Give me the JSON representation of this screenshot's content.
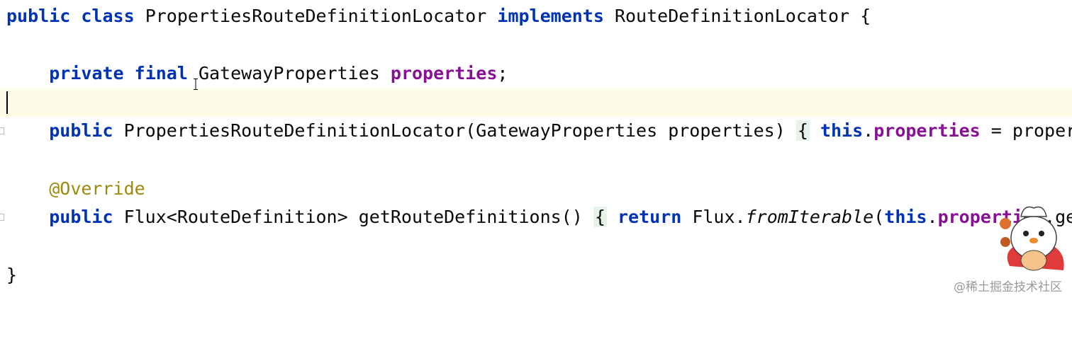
{
  "code": {
    "line1": {
      "kw_public": "public",
      "sp1": " ",
      "kw_class": "class",
      "sp2": " PropertiesRouteDefinitionLocator ",
      "kw_implements": "implements",
      "rest": " RouteDefinitionLocator {"
    },
    "line3": {
      "indent": "    ",
      "kw_private": "private",
      "sp1": " ",
      "kw_final": "final",
      "type": " GatewayProperties ",
      "field": "properties",
      "end": ";"
    },
    "line5": {
      "indent": "    ",
      "kw_public": "public",
      "sig": " PropertiesRouteDefinitionLocator(GatewayProperties properties) ",
      "brace": "{",
      "sp": " ",
      "kw_this": "this",
      "dot": ".",
      "field": "properties",
      "rest": " = properties"
    },
    "line7": {
      "indent": "    ",
      "annotation": "@Override"
    },
    "line8": {
      "indent": "    ",
      "kw_public": "public",
      "sig": " Flux<RouteDefinition> getRouteDefinitions() ",
      "brace": "{",
      "sp": " ",
      "kw_return": "return",
      "flux": " Flux.",
      "method": "fromIterable",
      "paren": "(",
      "kw_this": "this",
      "dot": ".",
      "field": "properties",
      "rest": ".getRou"
    },
    "line10": {
      "close": "}"
    }
  },
  "watermark": "@稀土掘金技术社区",
  "colors": {
    "keyword": "#0033b3",
    "field": "#871094",
    "annotation": "#9e880d",
    "current_line": "#fdfbe6",
    "brace_highlight": "#e7f3e8"
  },
  "icons": [
    "text-cursor-icon",
    "mascot-sticker-icon",
    "fold-marker-icon"
  ]
}
